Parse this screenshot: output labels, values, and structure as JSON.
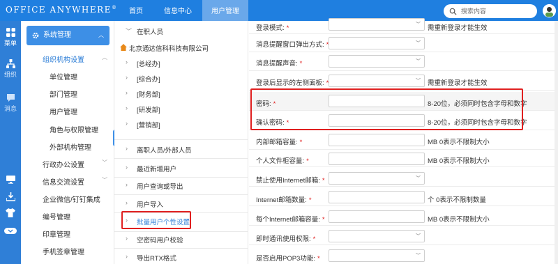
{
  "header": {
    "logo": "Office Anywhere",
    "logo_mark": "®",
    "tabs": [
      {
        "label": "首页"
      },
      {
        "label": "信息中心"
      },
      {
        "label": "用户管理"
      }
    ],
    "search_placeholder": "搜索内容"
  },
  "iconbar": {
    "items": [
      {
        "label": "菜单"
      },
      {
        "label": "组织"
      },
      {
        "label": "消息"
      }
    ]
  },
  "menu": {
    "section_title": "系统管理",
    "sub_title": "组织机构设置",
    "items": [
      {
        "label": "单位管理"
      },
      {
        "label": "部门管理"
      },
      {
        "label": "用户管理"
      },
      {
        "label": "角色与权限管理"
      },
      {
        "label": "外部机构管理"
      }
    ],
    "groups": [
      {
        "label": "行政办公设置"
      },
      {
        "label": "信息交流设置"
      },
      {
        "label": "企业微信/钉钉集成"
      },
      {
        "label": "编号管理"
      },
      {
        "label": "印章管理"
      },
      {
        "label": "手机签章管理"
      }
    ]
  },
  "tree": {
    "top": "在职人员",
    "company": "北京通达信科科技有限公司",
    "departments": [
      {
        "label": "[总经办]"
      },
      {
        "label": "[综合办]"
      },
      {
        "label": "[财务部]"
      },
      {
        "label": "[研发部]"
      },
      {
        "label": "[营销部]"
      }
    ],
    "sections": [
      {
        "label": "离职人员/外部人员"
      },
      {
        "label": "最近新增用户"
      },
      {
        "label": "用户查询或导出"
      },
      {
        "label": "用户导入"
      },
      {
        "label": "批量用户个性设置"
      },
      {
        "label": "空密码用户校验"
      },
      {
        "label": "导出RTX格式"
      }
    ]
  },
  "form": {
    "rows": [
      {
        "label": "登录模式:",
        "hint": "需重新登录才能生效"
      },
      {
        "label": "消息提醒窗口弹出方式:",
        "hint": ""
      },
      {
        "label": "消息提醒声音:",
        "hint": ""
      },
      {
        "label": "登录后显示的左侧面板:",
        "hint": "需重新登录才能生效"
      },
      {
        "label": "密码:",
        "hint": "8-20位，必须同时包含字母和数字"
      },
      {
        "label": "确认密码:",
        "hint": "8-20位，必须同时包含字母和数字"
      },
      {
        "label": "内部邮箱容量:",
        "hint": "MB 0表示不限制大小"
      },
      {
        "label": "个人文件柜容量:",
        "hint": "MB 0表示不限制大小"
      },
      {
        "label": "禁止使用Internet邮箱:",
        "hint": ""
      },
      {
        "label": "Internet邮箱数量:",
        "hint": "个 0表示不限制数量"
      },
      {
        "label": "每个Internet邮箱容量:",
        "hint": "MB 0表示不限制大小"
      },
      {
        "label": "即时通讯使用权限:",
        "hint": ""
      },
      {
        "label": "是否启用POP3功能:",
        "hint": ""
      }
    ]
  },
  "colors": {
    "brand": "#1f7fe0",
    "highlight": "#e02020"
  }
}
